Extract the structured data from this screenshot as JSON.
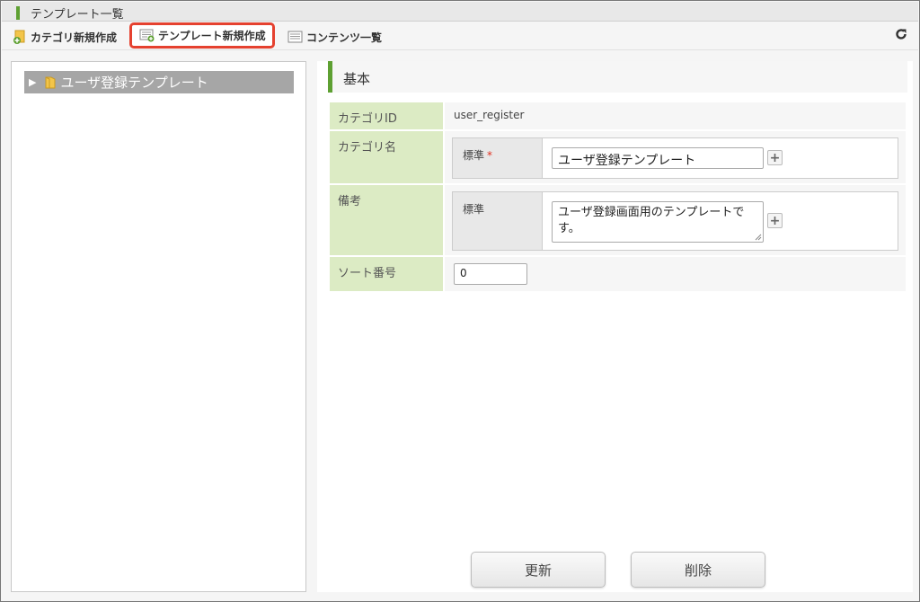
{
  "window": {
    "title": "テンプレート一覧"
  },
  "toolbar": {
    "new_category_label": "カテゴリ新規作成",
    "new_template_label": "テンプレート新規作成",
    "content_list_label": "コンテンツ一覧",
    "refresh_icon": "refresh-icon",
    "highlight_color": "#e5412f"
  },
  "tree": {
    "items": [
      {
        "label": "ユーザ登録テンプレート",
        "expanded": false,
        "icon": "folder-icon"
      }
    ]
  },
  "form": {
    "section_title": "基本",
    "accent_color": "#5ea032",
    "category_id": {
      "label": "カテゴリID",
      "value": "user_register"
    },
    "category_name": {
      "label": "カテゴリ名",
      "locale_label": "標準",
      "required_mark": "*",
      "value": "ユーザ登録テンプレート"
    },
    "remarks": {
      "label": "備考",
      "locale_label": "標準",
      "value": "ユーザ登録画面用のテンプレートです。"
    },
    "sort_order": {
      "label": "ソート番号",
      "value": "0"
    }
  },
  "actions": {
    "update_label": "更新",
    "delete_label": "削除"
  }
}
